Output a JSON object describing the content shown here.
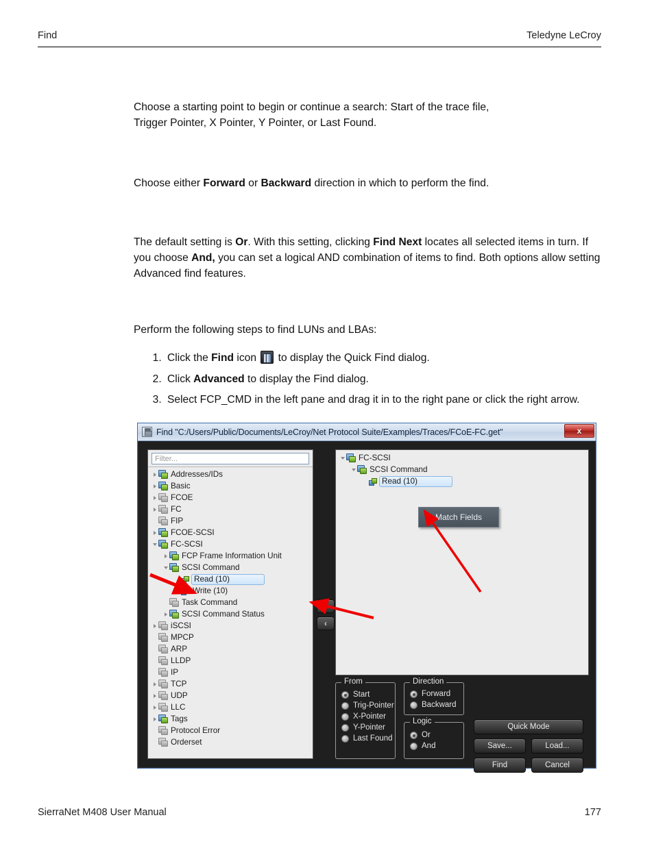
{
  "header": {
    "left": "Find",
    "right": "Teledyne LeCroy"
  },
  "footer": {
    "left": "SierraNet M408 User Manual",
    "page": "177"
  },
  "paragraphs": {
    "p1_line1": "Choose a starting point to begin or continue a search: Start of the trace file,",
    "p1_line2": "Trigger Pointer, X Pointer, Y Pointer, or Last Found.",
    "p2_a": "Choose either ",
    "p2_b1": "Forward",
    "p2_c": " or ",
    "p2_b2": "Backward",
    "p2_d": " direction in which to perform the find.",
    "p3_a": "The default setting is ",
    "p3_b1": "Or",
    "p3_c": ". With this setting, clicking ",
    "p3_b2": "Find Next",
    "p3_d": " locates all selected items in turn. If you choose ",
    "p3_b3": "And,",
    "p3_e": " you can set a logical AND combination of items to find. Both options allow setting Advanced find features.",
    "p4": "Perform the following steps to find LUNs and LBAs:"
  },
  "steps": {
    "s1_a": "Click the ",
    "s1_b": "Find",
    "s1_c": " icon ",
    "s1_d": " to display the Quick Find dialog.",
    "s2_a": "Click ",
    "s2_b": "Advanced",
    "s2_c": " to display the Find dialog.",
    "s3": "Select FCP_CMD in the left pane and drag it in to the right pane or click the right arrow."
  },
  "dialog": {
    "title": "Find \"C:/Users/Public/Documents/LeCroy/Net Protocol Suite/Examples/Traces/FCoE-FC.get\"",
    "close_label": "x",
    "filter_placeholder": "Filter...",
    "left_tree": [
      {
        "label": "Addresses/IDs",
        "indent": 1,
        "twist": "closed",
        "icon": "color"
      },
      {
        "label": "Basic",
        "indent": 1,
        "twist": "closed",
        "icon": "color"
      },
      {
        "label": "FCOE",
        "indent": 1,
        "twist": "closed",
        "icon": "gray"
      },
      {
        "label": "FC",
        "indent": 1,
        "twist": "closed",
        "icon": "gray"
      },
      {
        "label": "FIP",
        "indent": 1,
        "twist": "none",
        "icon": "gray"
      },
      {
        "label": "FCOE-SCSI",
        "indent": 1,
        "twist": "closed",
        "icon": "color"
      },
      {
        "label": "FC-SCSI",
        "indent": 1,
        "twist": "open",
        "icon": "color"
      },
      {
        "label": "FCP Frame Information Unit",
        "indent": 2,
        "twist": "closed",
        "icon": "color"
      },
      {
        "label": "SCSI Command",
        "indent": 2,
        "twist": "open",
        "icon": "color"
      },
      {
        "label": "Read (10)",
        "indent": 3,
        "twist": "none",
        "icon": "leaf",
        "selected": true
      },
      {
        "label": "Write (10)",
        "indent": 3,
        "twist": "none",
        "icon": "leaf"
      },
      {
        "label": "Task Command",
        "indent": 2,
        "twist": "none",
        "icon": "gray"
      },
      {
        "label": "SCSI Command Status",
        "indent": 2,
        "twist": "closed",
        "icon": "color"
      },
      {
        "label": "iSCSI",
        "indent": 1,
        "twist": "closed",
        "icon": "gray"
      },
      {
        "label": "MPCP",
        "indent": 1,
        "twist": "none",
        "icon": "gray"
      },
      {
        "label": "ARP",
        "indent": 1,
        "twist": "none",
        "icon": "gray"
      },
      {
        "label": "LLDP",
        "indent": 1,
        "twist": "none",
        "icon": "gray"
      },
      {
        "label": "IP",
        "indent": 1,
        "twist": "none",
        "icon": "gray"
      },
      {
        "label": "TCP",
        "indent": 1,
        "twist": "closed",
        "icon": "gray"
      },
      {
        "label": "UDP",
        "indent": 1,
        "twist": "closed",
        "icon": "gray"
      },
      {
        "label": "LLC",
        "indent": 1,
        "twist": "closed",
        "icon": "gray"
      },
      {
        "label": "Tags",
        "indent": 1,
        "twist": "closed",
        "icon": "color"
      },
      {
        "label": "Protocol Error",
        "indent": 1,
        "twist": "none",
        "icon": "gray"
      },
      {
        "label": "Orderset",
        "indent": 1,
        "twist": "none",
        "icon": "gray"
      }
    ],
    "right_tree": [
      {
        "label": "FC-SCSI",
        "indent": 1,
        "twist": "open",
        "icon": "color"
      },
      {
        "label": "SCSI Command",
        "indent": 2,
        "twist": "open",
        "icon": "color"
      },
      {
        "label": "Read (10)",
        "indent": 3,
        "twist": "none",
        "icon": "leaf",
        "selected": true
      }
    ],
    "context_menu": "Match Fields",
    "transfer": {
      "right": "›",
      "left": "‹"
    },
    "groups": {
      "from": {
        "legend": "From",
        "options": [
          {
            "label": "Start",
            "selected": true
          },
          {
            "label": "Trig-Pointer",
            "selected": false
          },
          {
            "label": "X-Pointer",
            "selected": false
          },
          {
            "label": "Y-Pointer",
            "selected": false
          },
          {
            "label": "Last Found",
            "selected": false
          }
        ]
      },
      "direction": {
        "legend": "Direction",
        "options": [
          {
            "label": "Forward",
            "selected": true
          },
          {
            "label": "Backward",
            "selected": false
          }
        ]
      },
      "logic": {
        "legend": "Logic",
        "options": [
          {
            "label": "Or",
            "selected": true
          },
          {
            "label": "And",
            "selected": false
          }
        ]
      }
    },
    "buttons": {
      "quick_mode": "Quick Mode",
      "save": "Save...",
      "load": "Load...",
      "find": "Find",
      "cancel": "Cancel"
    }
  },
  "colors": {
    "annotation_arrow": "#ee0000",
    "dialog_bg": "#1f1f1f",
    "pane_bg": "#ececec",
    "title_text": "#10243c"
  }
}
